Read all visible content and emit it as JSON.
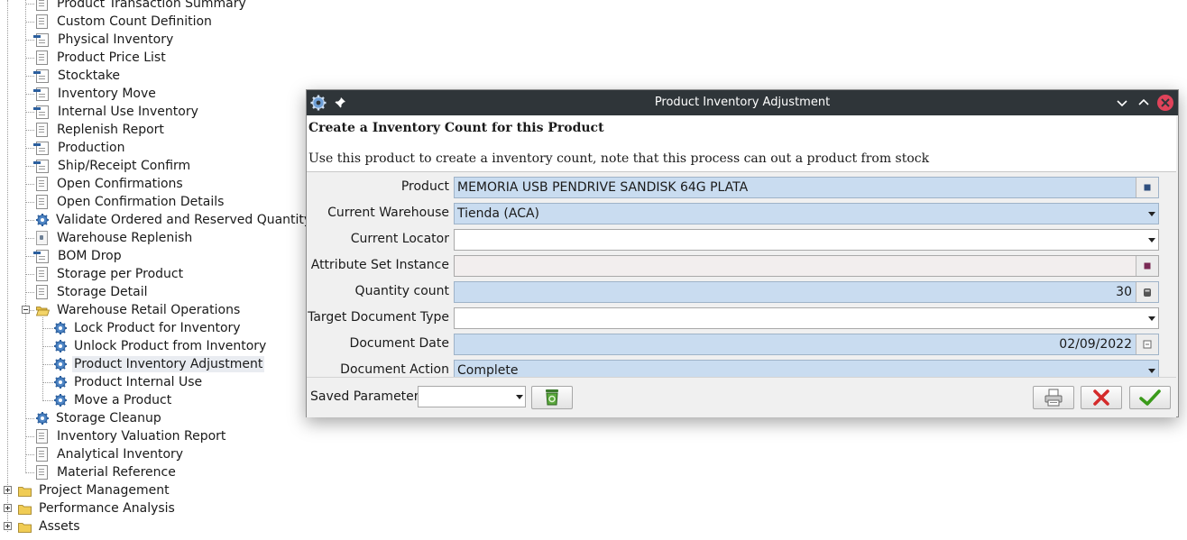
{
  "tree": {
    "items": [
      {
        "label": "Product Transaction Summary",
        "icon": "report"
      },
      {
        "label": "Custom Count Definition",
        "icon": "report"
      },
      {
        "label": "Physical Inventory",
        "icon": "window"
      },
      {
        "label": "Product Price List",
        "icon": "report"
      },
      {
        "label": "Stocktake",
        "icon": "window"
      },
      {
        "label": "Inventory Move",
        "icon": "window"
      },
      {
        "label": "Internal Use Inventory",
        "icon": "window"
      },
      {
        "label": "Replenish Report",
        "icon": "report"
      },
      {
        "label": "Production",
        "icon": "window"
      },
      {
        "label": "Ship/Receipt Confirm",
        "icon": "window"
      },
      {
        "label": "Open Confirmations",
        "icon": "report"
      },
      {
        "label": "Open Confirmation Details",
        "icon": "report"
      },
      {
        "label": "Validate Ordered and Reserved Quantity",
        "icon": "gear"
      },
      {
        "label": "Warehouse Replenish",
        "icon": "warehouse"
      },
      {
        "label": "BOM Drop",
        "icon": "window"
      },
      {
        "label": "Storage per Product",
        "icon": "report"
      },
      {
        "label": "Storage Detail",
        "icon": "report"
      },
      {
        "label": "Warehouse Retail Operations",
        "icon": "folder-open"
      },
      {
        "label": "Lock Product for Inventory",
        "icon": "gear"
      },
      {
        "label": "Unlock Product from Inventory",
        "icon": "gear"
      },
      {
        "label": "Product Inventory Adjustment",
        "icon": "gear"
      },
      {
        "label": "Product Internal Use",
        "icon": "gear"
      },
      {
        "label": "Move a Product",
        "icon": "gear"
      },
      {
        "label": "Storage Cleanup",
        "icon": "gear"
      },
      {
        "label": "Inventory Valuation Report",
        "icon": "report"
      },
      {
        "label": "Analytical Inventory",
        "icon": "report"
      },
      {
        "label": "Material Reference",
        "icon": "report"
      },
      {
        "label": "Project Management",
        "icon": "folder"
      },
      {
        "label": "Performance Analysis",
        "icon": "folder"
      },
      {
        "label": "Assets",
        "icon": "folder"
      }
    ]
  },
  "dialog": {
    "title": "Product Inventory Adjustment",
    "description_title": "Create a Inventory Count for this Product",
    "description_text": "Use this product to create a inventory count, note that this process can out a product from stock",
    "fields": [
      {
        "label": "Product",
        "value": "MEMORIA USB PENDRIVE SANDISK 64G PLATA"
      },
      {
        "label": "Current Warehouse",
        "value": "Tienda  (ACA)"
      },
      {
        "label": "Current Locator",
        "value": ""
      },
      {
        "label": "Attribute Set Instance",
        "value": ""
      },
      {
        "label": "Quantity count",
        "value": "30"
      },
      {
        "label": "Target Document Type",
        "value": ""
      },
      {
        "label": "Document Date",
        "value": "02/09/2022"
      },
      {
        "label": "Document Action",
        "value": "Complete"
      }
    ],
    "saved_parameter_label": "Saved Parameter",
    "saved_parameter_value": ""
  },
  "colors": {
    "titlebar": "#2f3539",
    "required_field": "#c9dcf0",
    "close_button": "#e0435a",
    "ok_check": "#3a9a1a",
    "cancel_x": "#d42a2a"
  }
}
